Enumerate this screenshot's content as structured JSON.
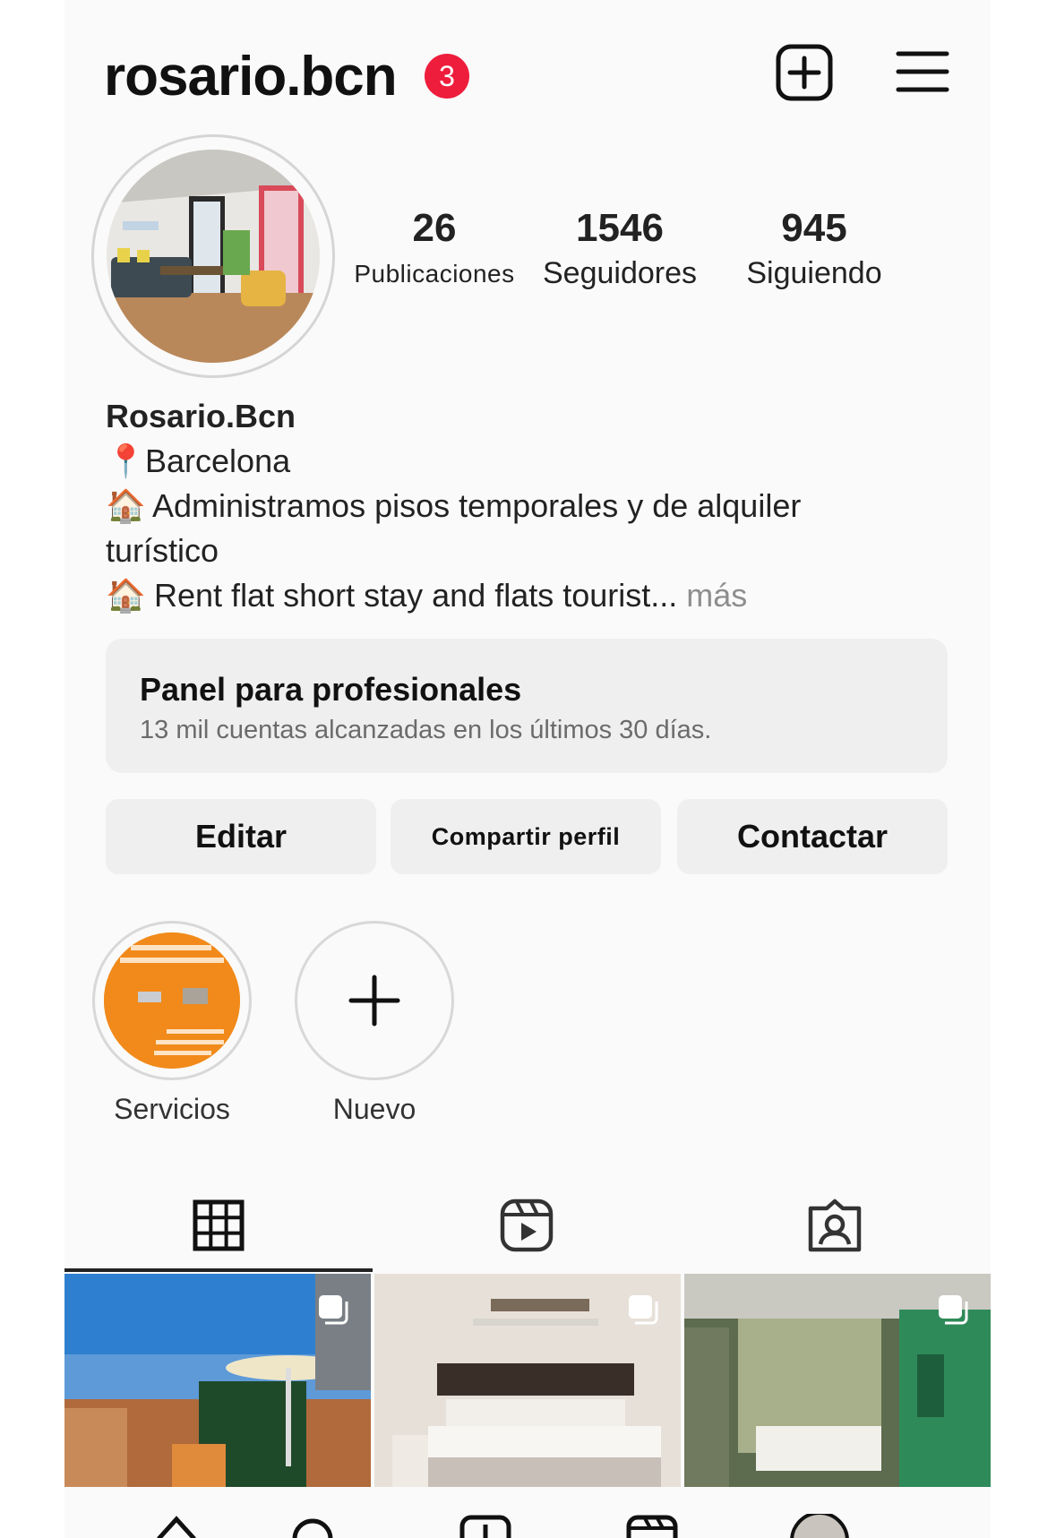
{
  "header": {
    "username": "rosario.bcn",
    "notification_count": "3",
    "icons": [
      "plus-square-icon",
      "hamburger-menu-icon"
    ]
  },
  "stats": {
    "posts": {
      "value": "26",
      "label": "Publicaciones"
    },
    "followers": {
      "value": "1546",
      "label": "Seguidores"
    },
    "following": {
      "value": "945",
      "label": "Siguiendo"
    }
  },
  "bio": {
    "name": "Rosario.Bcn",
    "location_emoji": "📍",
    "location": "Barcelona",
    "line1_emoji": "🏠",
    "line1": "Administramos pisos temporales y de alquiler",
    "line1_cont": "turístico",
    "line2_emoji": "🏠",
    "line2": "Rent flat short stay and flats tourist...",
    "more": "más"
  },
  "pro_panel": {
    "title": "Panel para profesionales",
    "subtitle": "13 mil cuentas alcanzadas en los últimos 30 días."
  },
  "buttons": {
    "edit": "Editar",
    "share": "Compartir perfil",
    "contact": "Contactar"
  },
  "highlights": [
    {
      "label": "Servicios"
    },
    {
      "label": "Nuevo"
    }
  ],
  "tabs": [
    "grid-icon",
    "reels-icon",
    "tagged-icon"
  ],
  "accent": {
    "badge": "#ee1d3c",
    "highlight_orange": "#f18a1a"
  }
}
